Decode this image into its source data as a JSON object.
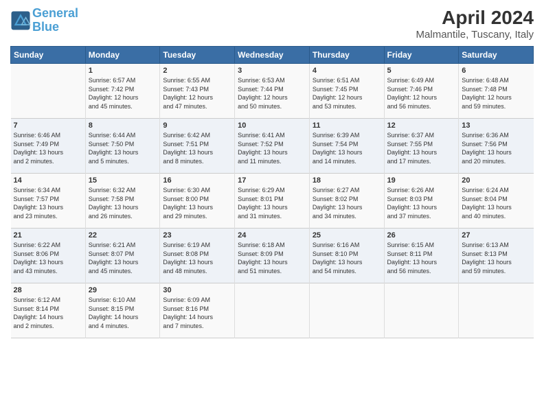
{
  "header": {
    "logo_line1": "General",
    "logo_line2": "Blue",
    "title": "April 2024",
    "subtitle": "Malmantile, Tuscany, Italy"
  },
  "columns": [
    "Sunday",
    "Monday",
    "Tuesday",
    "Wednesday",
    "Thursday",
    "Friday",
    "Saturday"
  ],
  "weeks": [
    [
      {
        "day": "",
        "content": ""
      },
      {
        "day": "1",
        "content": "Sunrise: 6:57 AM\nSunset: 7:42 PM\nDaylight: 12 hours\nand 45 minutes."
      },
      {
        "day": "2",
        "content": "Sunrise: 6:55 AM\nSunset: 7:43 PM\nDaylight: 12 hours\nand 47 minutes."
      },
      {
        "day": "3",
        "content": "Sunrise: 6:53 AM\nSunset: 7:44 PM\nDaylight: 12 hours\nand 50 minutes."
      },
      {
        "day": "4",
        "content": "Sunrise: 6:51 AM\nSunset: 7:45 PM\nDaylight: 12 hours\nand 53 minutes."
      },
      {
        "day": "5",
        "content": "Sunrise: 6:49 AM\nSunset: 7:46 PM\nDaylight: 12 hours\nand 56 minutes."
      },
      {
        "day": "6",
        "content": "Sunrise: 6:48 AM\nSunset: 7:48 PM\nDaylight: 12 hours\nand 59 minutes."
      }
    ],
    [
      {
        "day": "7",
        "content": "Sunrise: 6:46 AM\nSunset: 7:49 PM\nDaylight: 13 hours\nand 2 minutes."
      },
      {
        "day": "8",
        "content": "Sunrise: 6:44 AM\nSunset: 7:50 PM\nDaylight: 13 hours\nand 5 minutes."
      },
      {
        "day": "9",
        "content": "Sunrise: 6:42 AM\nSunset: 7:51 PM\nDaylight: 13 hours\nand 8 minutes."
      },
      {
        "day": "10",
        "content": "Sunrise: 6:41 AM\nSunset: 7:52 PM\nDaylight: 13 hours\nand 11 minutes."
      },
      {
        "day": "11",
        "content": "Sunrise: 6:39 AM\nSunset: 7:54 PM\nDaylight: 13 hours\nand 14 minutes."
      },
      {
        "day": "12",
        "content": "Sunrise: 6:37 AM\nSunset: 7:55 PM\nDaylight: 13 hours\nand 17 minutes."
      },
      {
        "day": "13",
        "content": "Sunrise: 6:36 AM\nSunset: 7:56 PM\nDaylight: 13 hours\nand 20 minutes."
      }
    ],
    [
      {
        "day": "14",
        "content": "Sunrise: 6:34 AM\nSunset: 7:57 PM\nDaylight: 13 hours\nand 23 minutes."
      },
      {
        "day": "15",
        "content": "Sunrise: 6:32 AM\nSunset: 7:58 PM\nDaylight: 13 hours\nand 26 minutes."
      },
      {
        "day": "16",
        "content": "Sunrise: 6:30 AM\nSunset: 8:00 PM\nDaylight: 13 hours\nand 29 minutes."
      },
      {
        "day": "17",
        "content": "Sunrise: 6:29 AM\nSunset: 8:01 PM\nDaylight: 13 hours\nand 31 minutes."
      },
      {
        "day": "18",
        "content": "Sunrise: 6:27 AM\nSunset: 8:02 PM\nDaylight: 13 hours\nand 34 minutes."
      },
      {
        "day": "19",
        "content": "Sunrise: 6:26 AM\nSunset: 8:03 PM\nDaylight: 13 hours\nand 37 minutes."
      },
      {
        "day": "20",
        "content": "Sunrise: 6:24 AM\nSunset: 8:04 PM\nDaylight: 13 hours\nand 40 minutes."
      }
    ],
    [
      {
        "day": "21",
        "content": "Sunrise: 6:22 AM\nSunset: 8:06 PM\nDaylight: 13 hours\nand 43 minutes."
      },
      {
        "day": "22",
        "content": "Sunrise: 6:21 AM\nSunset: 8:07 PM\nDaylight: 13 hours\nand 45 minutes."
      },
      {
        "day": "23",
        "content": "Sunrise: 6:19 AM\nSunset: 8:08 PM\nDaylight: 13 hours\nand 48 minutes."
      },
      {
        "day": "24",
        "content": "Sunrise: 6:18 AM\nSunset: 8:09 PM\nDaylight: 13 hours\nand 51 minutes."
      },
      {
        "day": "25",
        "content": "Sunrise: 6:16 AM\nSunset: 8:10 PM\nDaylight: 13 hours\nand 54 minutes."
      },
      {
        "day": "26",
        "content": "Sunrise: 6:15 AM\nSunset: 8:11 PM\nDaylight: 13 hours\nand 56 minutes."
      },
      {
        "day": "27",
        "content": "Sunrise: 6:13 AM\nSunset: 8:13 PM\nDaylight: 13 hours\nand 59 minutes."
      }
    ],
    [
      {
        "day": "28",
        "content": "Sunrise: 6:12 AM\nSunset: 8:14 PM\nDaylight: 14 hours\nand 2 minutes."
      },
      {
        "day": "29",
        "content": "Sunrise: 6:10 AM\nSunset: 8:15 PM\nDaylight: 14 hours\nand 4 minutes."
      },
      {
        "day": "30",
        "content": "Sunrise: 6:09 AM\nSunset: 8:16 PM\nDaylight: 14 hours\nand 7 minutes."
      },
      {
        "day": "",
        "content": ""
      },
      {
        "day": "",
        "content": ""
      },
      {
        "day": "",
        "content": ""
      },
      {
        "day": "",
        "content": ""
      }
    ]
  ]
}
